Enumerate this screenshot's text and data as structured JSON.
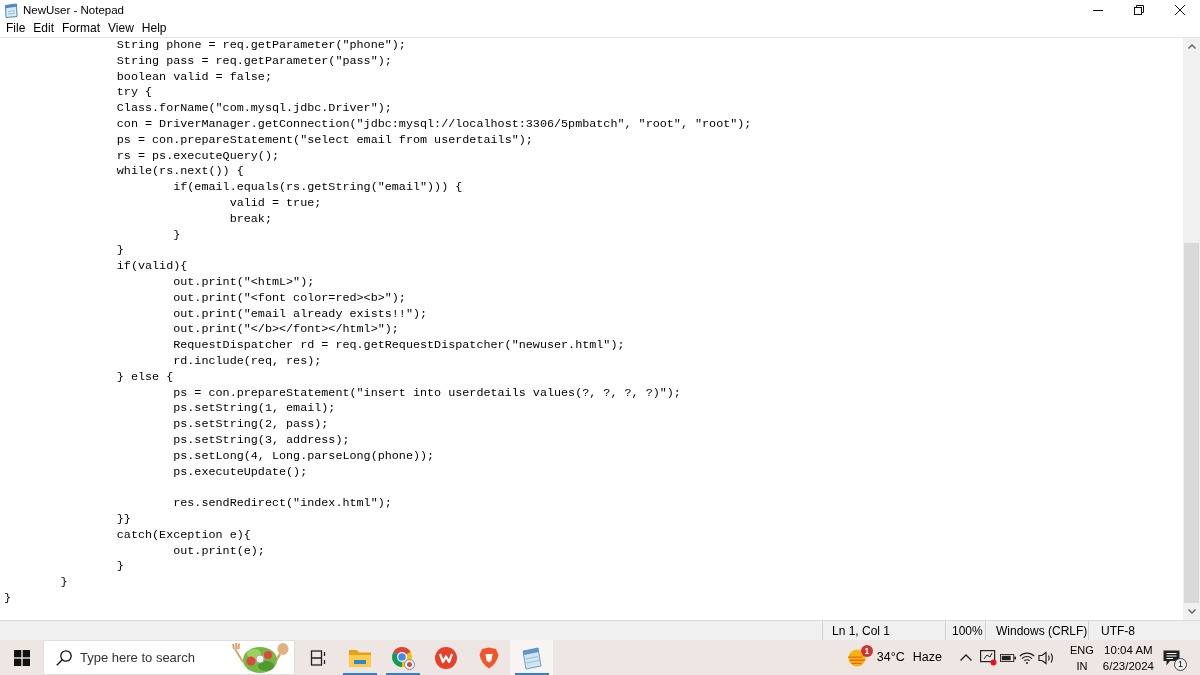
{
  "window": {
    "title": "NewUser - Notepad"
  },
  "menu": [
    {
      "label": "File"
    },
    {
      "label": "Edit"
    },
    {
      "label": "Format"
    },
    {
      "label": "View"
    },
    {
      "label": "Help"
    }
  ],
  "editor": {
    "blocks": [
      {
        "lines": [
          "\t\tString phone = req.getParameter(\"phone\");",
          "\t\tString pass = req.getParameter(\"pass\");",
          "\t\tboolean valid = false;",
          "\t\ttry {",
          "\t\tClass.forName(\"com.mysql.jdbc.Driver\");",
          "\t\tcon = DriverManager.getConnection(\"jdbc:mysql://localhost:3306/5pmbatch\", \"root\", \"root\");",
          "\t\tps = con.prepareStatement(\"select email from userdetails\");",
          "\t\trs = ps.executeQuery();",
          "\t\twhile(rs.next()) {",
          "\t\t\tif(email.equals(rs.getString(\"email\"))) {",
          "\t\t\t\tvalid = true;",
          "\t\t\t\tbreak;",
          "\t\t\t}",
          "\t\t}",
          "\t\tif(valid){",
          "\t\t\tout.print(\"<htmL>\");",
          "\t\t\tout.print(\"<font color=red><b>\");",
          "\t\t\tout.print(\"email already exists!!\");",
          "\t\t\tout.print(\"</b></font></html>\");",
          "\t\t\tRequestDispatcher rd = req.getRequestDispatcher(\"newuser.html\");",
          "\t\t\trd.include(req, res);",
          "\t\t} else {",
          "\t\t\tps = con.prepareStatement(\"insert into userdetails values(?, ?, ?, ?)\");",
          "\t\t\tps.setString(1, email);",
          "\t\t\tps.setString(2, pass);",
          "\t\t\tps.setString(3, address);",
          "\t\t\tps.setLong(4, Long.parseLong(phone));",
          "\t\t\tps.executeUpdate();"
        ]
      },
      {
        "lines": [
          "\t\t\tres.sendRedirect(\"index.html\");",
          "\t\t}}",
          "\t\tcatch(Exception e){",
          "\t\t\tout.print(e);",
          "\t\t}",
          "\t}",
          "}"
        ]
      }
    ]
  },
  "status_bar": {
    "position": "Ln 1, Col 1",
    "zoom": "100%",
    "line_ending": "Windows (CRLF)",
    "encoding": "UTF-8"
  },
  "taskbar": {
    "search": {
      "placeholder": "Type here to search"
    },
    "apps": [
      {
        "kind": "folder",
        "indicator": true,
        "selected": false
      },
      {
        "kind": "browser",
        "indicator": true,
        "selected": false
      },
      {
        "kind": "office",
        "indicator": false,
        "selected": false
      },
      {
        "kind": "shield",
        "indicator": false,
        "selected": false
      },
      {
        "kind": "notepad",
        "indicator": true,
        "selected": true
      }
    ],
    "weather": {
      "badge": "1",
      "temperature": "34°C",
      "condition": "Haze"
    },
    "language": {
      "code": "ENG",
      "region": "IN"
    },
    "clock": {
      "time": "10:04 AM",
      "date": "6/23/2024"
    },
    "notifications": {
      "count": "1"
    }
  }
}
